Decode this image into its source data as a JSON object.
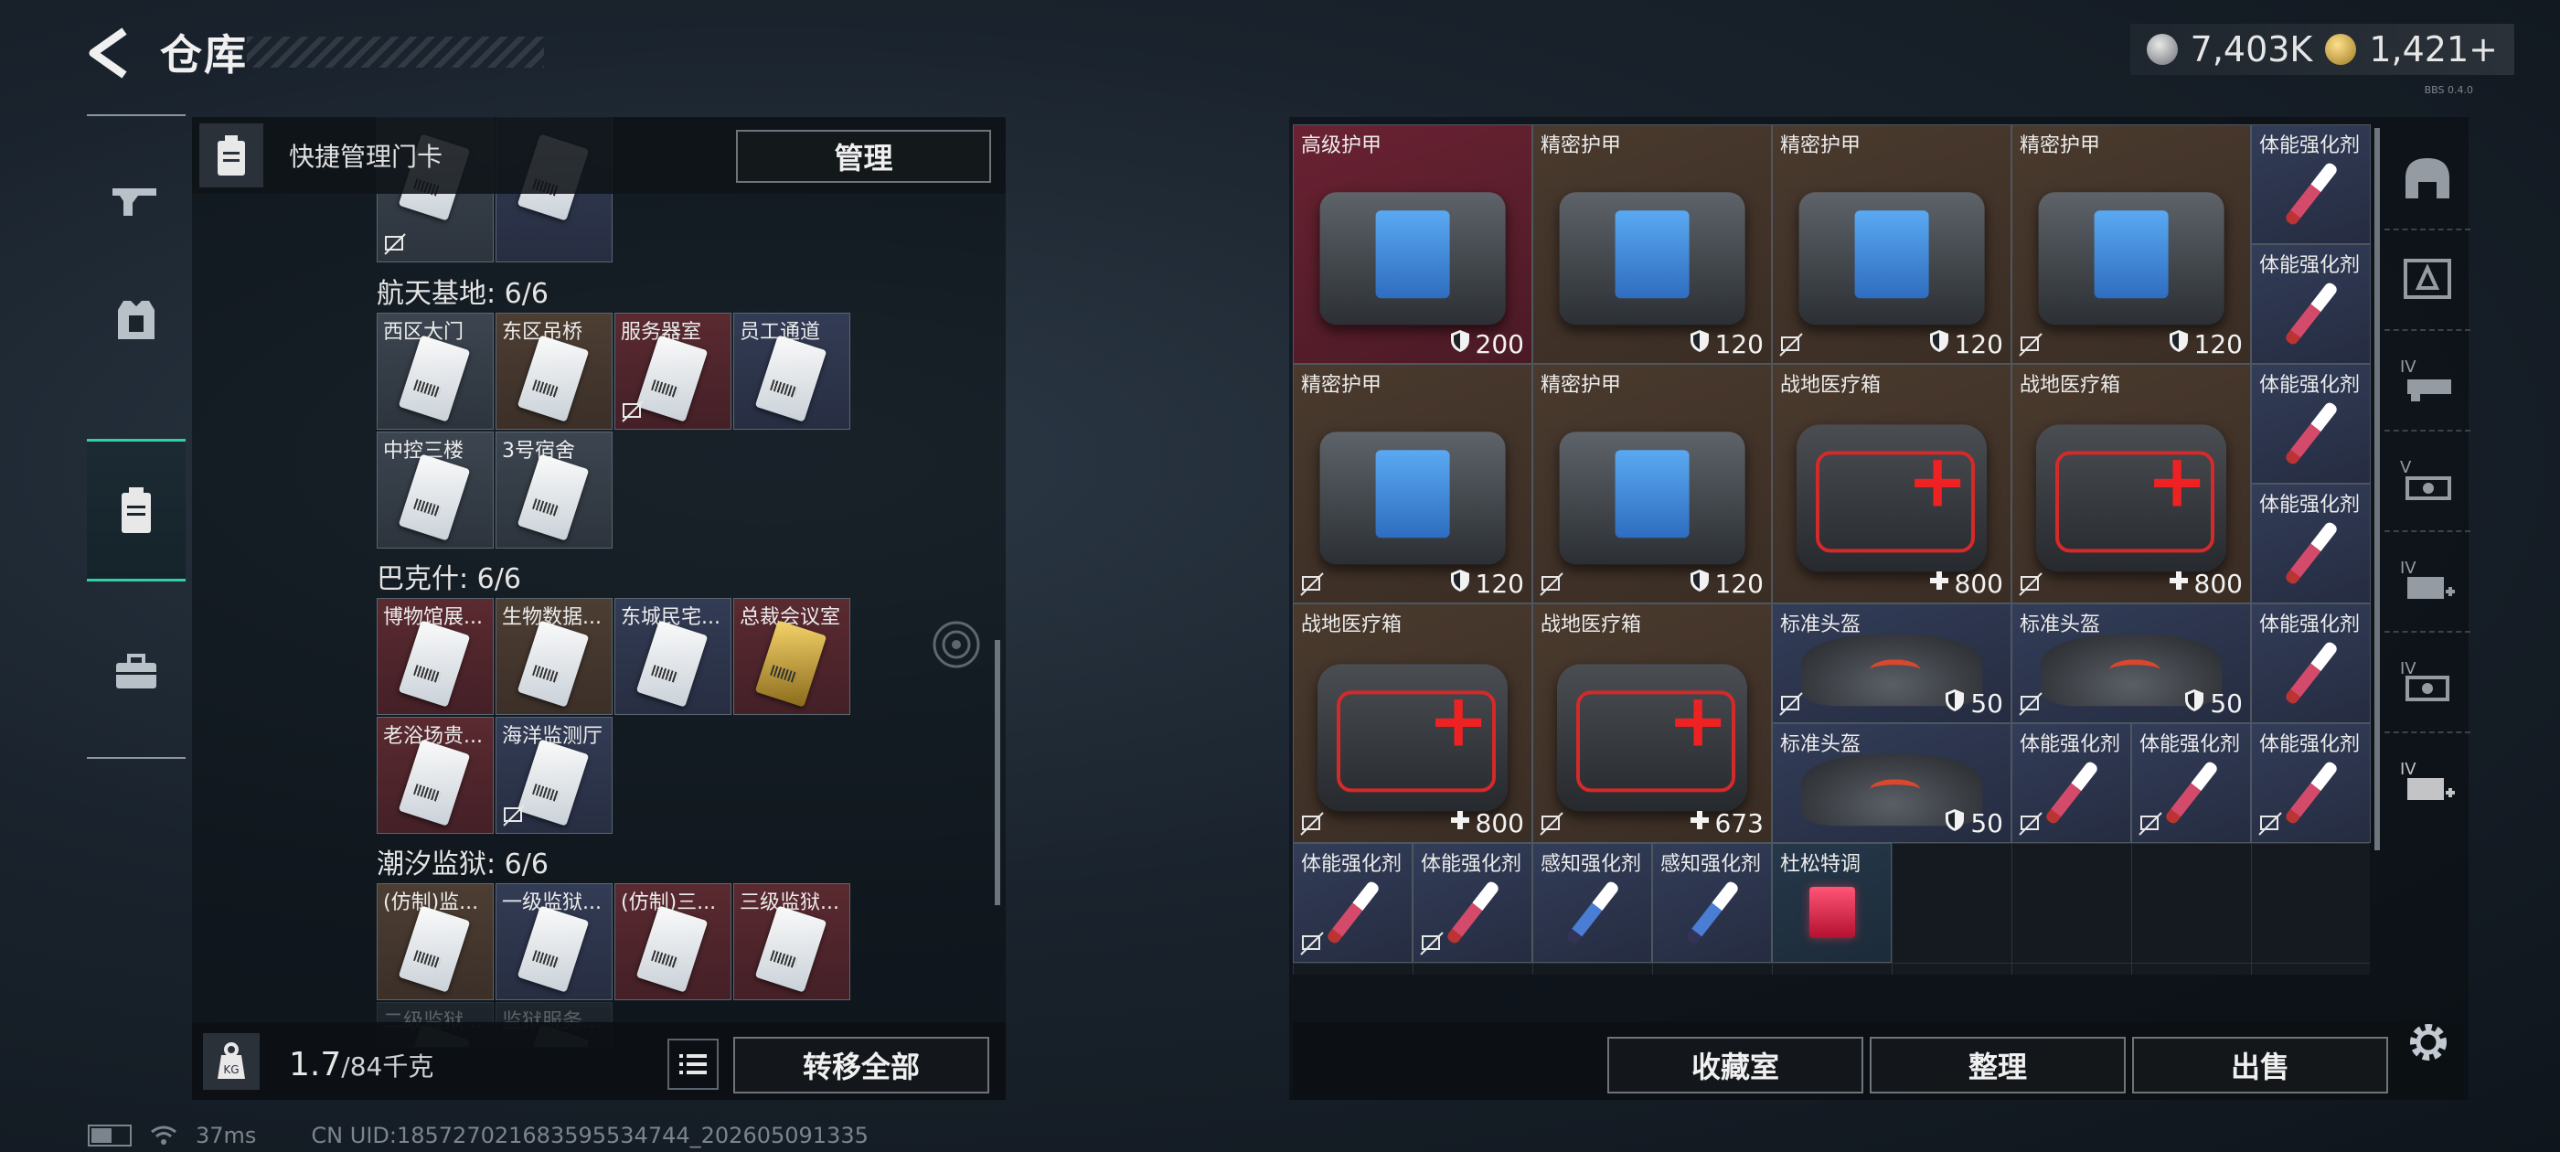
{
  "header": {
    "title": "仓库",
    "currency": [
      {
        "icon": "silver-coin-icon",
        "value": "7,403K"
      },
      {
        "icon": "gold-coin-icon",
        "value": "1,421+"
      }
    ],
    "version": "BBS 0.4.0"
  },
  "left_nav": [
    {
      "icon": "gun-icon",
      "active": false
    },
    {
      "icon": "armor-vest-icon",
      "active": false
    },
    {
      "icon": "keycard-icon",
      "active": true
    },
    {
      "icon": "toolbox-icon",
      "active": false
    }
  ],
  "left_panel": {
    "header_label": "快捷管理门卡",
    "manage_label": "管理",
    "sections": [
      {
        "title": "航天基地: 6/6",
        "cards": [
          {
            "name": "西区大门",
            "tint": "grey",
            "locked": false
          },
          {
            "name": "东区吊桥",
            "tint": "brown",
            "locked": false
          },
          {
            "name": "服务器室",
            "tint": "red",
            "locked": true
          },
          {
            "name": "员工通道",
            "tint": "blue",
            "locked": false
          },
          {
            "name": "中控三楼",
            "tint": "grey",
            "locked": false
          },
          {
            "name": "3号宿舍",
            "tint": "grey",
            "locked": false
          }
        ]
      },
      {
        "title": "巴克什: 6/6",
        "cards": [
          {
            "name": "博物馆展...",
            "tint": "red",
            "locked": false
          },
          {
            "name": "生物数据...",
            "tint": "brown",
            "locked": false
          },
          {
            "name": "东城民宅...",
            "tint": "blue",
            "locked": false
          },
          {
            "name": "总裁会议室",
            "tint": "red",
            "locked": false
          },
          {
            "name": "老浴场贵...",
            "tint": "red",
            "locked": false
          },
          {
            "name": "海洋监测厅",
            "tint": "blue",
            "locked": true
          }
        ]
      },
      {
        "title": "潮汐监狱: 6/6",
        "cards": [
          {
            "name": "(仿制)监...",
            "tint": "brown",
            "locked": false
          },
          {
            "name": "一级监狱...",
            "tint": "blue",
            "locked": false
          },
          {
            "name": "(仿制)三...",
            "tint": "red",
            "locked": false
          },
          {
            "name": "三级监狱...",
            "tint": "red",
            "locked": false
          },
          {
            "name": "二级监狱...",
            "tint": "grey",
            "locked": false
          },
          {
            "name": "监狱服务...",
            "tint": "grey",
            "locked": false
          }
        ]
      }
    ],
    "weight_current": "1.7",
    "weight_max": "/84千克",
    "transfer_all_label": "转移全部"
  },
  "status_bar": {
    "ping": "37ms",
    "uid": "CN UID:185727021683595534744_202605091335"
  },
  "stash": {
    "items": [
      {
        "name": "高级护甲",
        "kind": "armor",
        "tint": "red",
        "value": "200",
        "value_icon": "shield-icon",
        "locked": false
      },
      {
        "name": "精密护甲",
        "kind": "armor",
        "tint": "brown",
        "value": "120",
        "value_icon": "shield-icon",
        "locked": false
      },
      {
        "name": "精密护甲",
        "kind": "armor",
        "tint": "brown",
        "value": "120",
        "value_icon": "shield-icon",
        "locked": true
      },
      {
        "name": "精密护甲",
        "kind": "armor",
        "tint": "brown",
        "value": "120",
        "value_icon": "shield-icon",
        "locked": true
      },
      {
        "name": "精密护甲",
        "kind": "armor",
        "tint": "brown",
        "value": "120",
        "value_icon": "shield-icon",
        "locked": true
      },
      {
        "name": "精密护甲",
        "kind": "armor",
        "tint": "brown",
        "value": "120",
        "value_icon": "shield-icon",
        "locked": true
      },
      {
        "name": "战地医疗箱",
        "kind": "medkit",
        "tint": "brown",
        "value": "800",
        "value_icon": "plus-icon",
        "locked": false
      },
      {
        "name": "战地医疗箱",
        "kind": "medkit",
        "tint": "brown",
        "value": "800",
        "value_icon": "plus-icon",
        "locked": true
      },
      {
        "name": "战地医疗箱",
        "kind": "medkit",
        "tint": "brown",
        "value": "800",
        "value_icon": "plus-icon",
        "locked": true
      },
      {
        "name": "战地医疗箱",
        "kind": "medkit",
        "tint": "brown",
        "value": "673",
        "value_icon": "plus-icon",
        "locked": true
      },
      {
        "name": "标准头盔",
        "kind": "helmet",
        "tint": "blue",
        "value": "50",
        "value_icon": "shield-icon",
        "locked": true
      },
      {
        "name": "标准头盔",
        "kind": "helmet",
        "tint": "blue",
        "value": "50",
        "value_icon": "shield-icon",
        "locked": true
      },
      {
        "name": "标准头盔",
        "kind": "helmet",
        "tint": "blue",
        "value": "50",
        "value_icon": "shield-icon",
        "locked": false
      },
      {
        "name": "体能强化剂",
        "kind": "syringe",
        "tint": "blue",
        "value": "",
        "locked": false
      },
      {
        "name": "体能强化剂",
        "kind": "syringe",
        "tint": "blue",
        "value": "",
        "locked": false
      },
      {
        "name": "体能强化剂",
        "kind": "syringe",
        "tint": "blue",
        "value": "",
        "locked": false
      },
      {
        "name": "体能强化剂",
        "kind": "syringe",
        "tint": "blue",
        "value": "",
        "locked": false
      },
      {
        "name": "体能强化剂",
        "kind": "syringe",
        "tint": "blue",
        "value": "",
        "locked": false
      },
      {
        "name": "体能强化剂",
        "kind": "syringe",
        "tint": "blue",
        "value": "",
        "locked": true
      },
      {
        "name": "体能强化剂",
        "kind": "syringe",
        "tint": "blue",
        "value": "",
        "locked": true
      },
      {
        "name": "体能强化剂",
        "kind": "syringe",
        "tint": "blue",
        "value": "",
        "locked": true
      },
      {
        "name": "体能强化剂",
        "kind": "syringe",
        "tint": "blue",
        "value": "",
        "locked": true
      },
      {
        "name": "体能强化剂",
        "kind": "syringe",
        "tint": "blue",
        "value": "",
        "locked": true
      },
      {
        "name": "感知强化剂",
        "kind": "syringe-blue",
        "tint": "blue",
        "value": "",
        "locked": false
      },
      {
        "name": "感知强化剂",
        "kind": "syringe-blue",
        "tint": "blue",
        "value": "",
        "locked": false
      },
      {
        "name": "杜松特调",
        "kind": "drink",
        "tint": "teal",
        "value": "",
        "locked": false
      }
    ],
    "buttons": {
      "collection": "收藏室",
      "sort": "整理",
      "sell": "出售"
    }
  },
  "right_nav": [
    {
      "icon": "helmet-category-icon"
    },
    {
      "icon": "armor-category-icon"
    },
    {
      "icon": "weapon-tier-icon"
    },
    {
      "icon": "weapon-tier-icon"
    },
    {
      "icon": "medkit-tier-icon"
    },
    {
      "icon": "medkit-tier-icon"
    },
    {
      "icon": "medkit-tier-icon"
    }
  ],
  "colors": {
    "accent": "#2fd0a5",
    "red_tint": "#5a2a30",
    "brown_tint": "#4a3a2e",
    "blue_tint": "#333c55"
  }
}
